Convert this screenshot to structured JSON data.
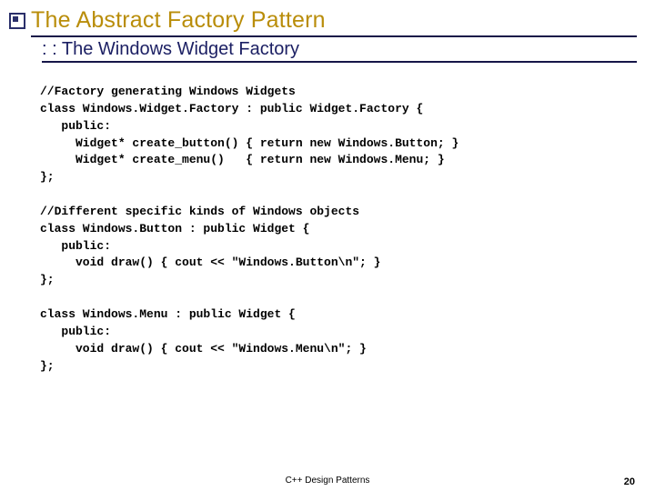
{
  "title": "The Abstract Factory Pattern",
  "subtitle": ": : The Windows Widget Factory",
  "code": "//Factory generating Windows Widgets\nclass Windows.Widget.Factory : public Widget.Factory {\n   public:\n     Widget* create_button() { return new Windows.Button; }\n     Widget* create_menu()   { return new Windows.Menu; }\n};\n\n//Different specific kinds of Windows objects\nclass Windows.Button : public Widget {\n   public:\n     void draw() { cout << \"Windows.Button\\n\"; }\n};\n\nclass Windows.Menu : public Widget {\n   public:\n     void draw() { cout << \"Windows.Menu\\n\"; }\n};",
  "footer": {
    "center": "C++ Design Patterns",
    "page": "20"
  }
}
